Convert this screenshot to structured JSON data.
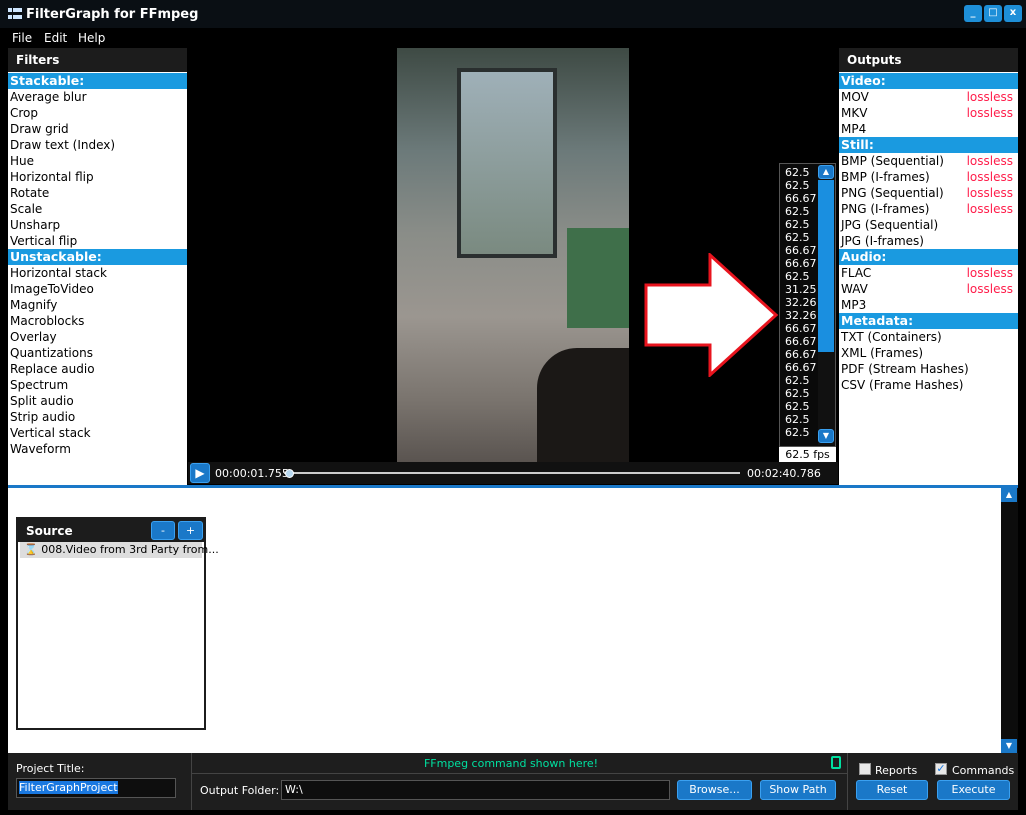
{
  "window": {
    "title": "FilterGraph for FFmpeg",
    "minimize": "_",
    "maximize": "□",
    "close": "x"
  },
  "menu": [
    "File",
    "Edit",
    "Help"
  ],
  "filters": {
    "header": "Filters",
    "items": [
      {
        "label": "Stackable:",
        "category": true
      },
      {
        "label": "Average blur"
      },
      {
        "label": "Crop"
      },
      {
        "label": "Draw grid"
      },
      {
        "label": "Draw text (Index)"
      },
      {
        "label": "Hue"
      },
      {
        "label": "Horizontal flip"
      },
      {
        "label": "Rotate"
      },
      {
        "label": "Scale"
      },
      {
        "label": "Unsharp"
      },
      {
        "label": "Vertical flip"
      },
      {
        "label": "Unstackable:",
        "category": true
      },
      {
        "label": "Horizontal stack"
      },
      {
        "label": "ImageToVideo"
      },
      {
        "label": "Magnify"
      },
      {
        "label": "Macroblocks"
      },
      {
        "label": "Overlay"
      },
      {
        "label": "Quantizations"
      },
      {
        "label": "Replace audio"
      },
      {
        "label": "Spectrum"
      },
      {
        "label": "Split audio"
      },
      {
        "label": "Strip audio"
      },
      {
        "label": "Vertical stack"
      },
      {
        "label": "Waveform"
      }
    ]
  },
  "outputs": {
    "header": "Outputs",
    "items": [
      {
        "label": "Video:",
        "category": true
      },
      {
        "label": "MOV",
        "tag": "lossless"
      },
      {
        "label": "MKV",
        "tag": "lossless"
      },
      {
        "label": "MP4"
      },
      {
        "label": "Still:",
        "category": true
      },
      {
        "label": "BMP (Sequential)",
        "tag": "lossless"
      },
      {
        "label": "BMP (I-frames)",
        "tag": "lossless"
      },
      {
        "label": "PNG (Sequential)",
        "tag": "lossless"
      },
      {
        "label": "PNG (I-frames)",
        "tag": "lossless"
      },
      {
        "label": "JPG (Sequential)"
      },
      {
        "label": "JPG (I-frames)"
      },
      {
        "label": "Audio:",
        "category": true
      },
      {
        "label": "FLAC",
        "tag": "lossless"
      },
      {
        "label": "WAV",
        "tag": "lossless"
      },
      {
        "label": "MP3"
      },
      {
        "label": "Metadata:",
        "category": true
      },
      {
        "label": "TXT (Containers)"
      },
      {
        "label": "XML (Frames)"
      },
      {
        "label": "PDF (Stream Hashes)"
      },
      {
        "label": "CSV (Frame Hashes)"
      }
    ]
  },
  "player": {
    "current_time": "00:00:01.755",
    "total_time": "00:02:40.786",
    "progress": 0.011,
    "fps": "62.5 fps",
    "frame_rates": [
      "62.5",
      "62.5",
      "66.67",
      "62.5",
      "62.5",
      "62.5",
      "66.67",
      "66.67",
      "62.5",
      "31.25",
      "32.26",
      "32.26",
      "66.67",
      "66.67",
      "66.67",
      "66.67",
      "62.5",
      "62.5",
      "62.5",
      "62.5",
      "62.5"
    ]
  },
  "source": {
    "header": "Source",
    "minus": "-",
    "plus": "+",
    "item": "008.Video from 3rd Party from..."
  },
  "bottom": {
    "project_title_label": "Project Title:",
    "project_title": "FilterGraphProject",
    "command_hint": "FFmpeg command shown here!",
    "output_folder_label": "Output Folder:",
    "output_folder": "W:\\",
    "browse": "Browse...",
    "show_path": "Show Path",
    "reports": "Reports",
    "reports_checked": false,
    "commands": "Commands",
    "commands_checked": true,
    "reset": "Reset",
    "execute": "Execute"
  },
  "colors": {
    "accent": "#1a9ae0",
    "lossless": "#ff1d4a",
    "hint": "#00e0a0"
  }
}
